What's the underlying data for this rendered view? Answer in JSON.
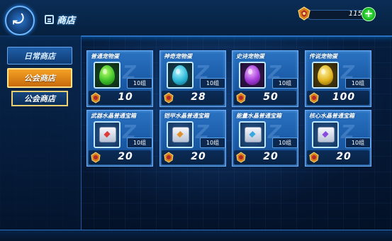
{
  "header": {
    "title": "商店",
    "currency_amount": "115",
    "icons": {
      "back": "back-arrow-icon",
      "shop": "shop-icon",
      "currency": "emblem-currency-icon",
      "add": "plus-icon"
    }
  },
  "sidebar": {
    "tabs": [
      {
        "label": "日常商店",
        "state": "normal"
      },
      {
        "label": "公会商店",
        "state": "active"
      },
      {
        "label": "公会商店",
        "state": "sub"
      }
    ]
  },
  "shop": {
    "items": [
      {
        "name": "普通宠物蛋",
        "qty": "10组",
        "price": "10",
        "icon": "green-egg-icon",
        "color": "#3ec22a"
      },
      {
        "name": "神奇宠物蛋",
        "qty": "10组",
        "price": "28",
        "icon": "cyan-egg-icon",
        "color": "#2bb8d8"
      },
      {
        "name": "史诗宠物蛋",
        "qty": "10组",
        "price": "50",
        "icon": "purple-egg-icon",
        "color": "#a23ad8"
      },
      {
        "name": "传说宠物蛋",
        "qty": "10组",
        "price": "100",
        "icon": "gold-egg-icon",
        "color": "#e0b21c"
      },
      {
        "name": "武器水晶普通宝箱",
        "qty": "10组",
        "price": "20",
        "icon": "weapon-crystal-chest-icon",
        "color": "#e03a3a"
      },
      {
        "name": "铠甲水晶普通宝箱",
        "qty": "10组",
        "price": "20",
        "icon": "armor-crystal-chest-icon",
        "color": "#e0902a"
      },
      {
        "name": "能量水晶普通宝箱",
        "qty": "10组",
        "price": "20",
        "icon": "energy-crystal-chest-icon",
        "color": "#3aa8e0"
      },
      {
        "name": "核心水晶普通宝箱",
        "qty": "10组",
        "price": "20",
        "icon": "core-crystal-chest-icon",
        "color": "#8a4ae0"
      }
    ],
    "price_icon": "emblem-coin-icon"
  }
}
